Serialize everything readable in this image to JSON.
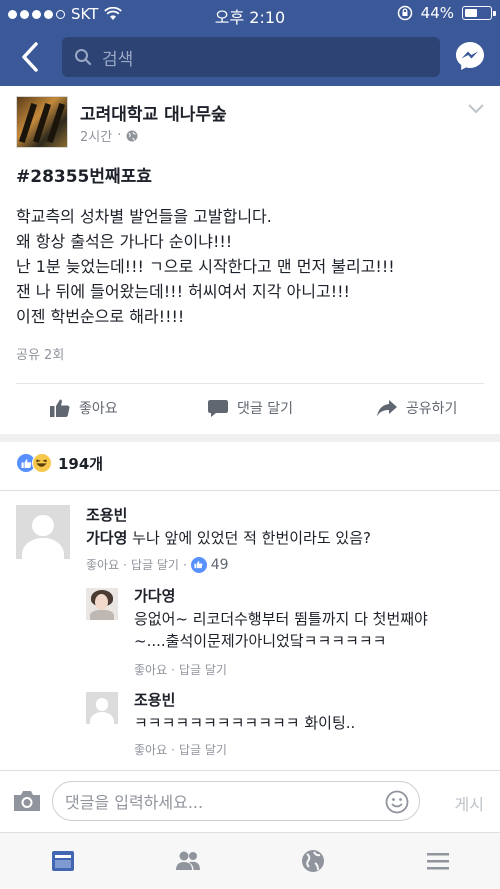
{
  "status": {
    "carrier": "SKT",
    "time": "오후 2:10",
    "battery": "44%",
    "battery_level": 0.44
  },
  "nav": {
    "search_placeholder": "검색"
  },
  "post": {
    "page_name": "고려대학교 대나무숲",
    "time": "2시간",
    "hashtag": "#28355번째포효",
    "lines": [
      "학교측의 성차별 발언들을 고발합니다.",
      "왜 항상 출석은 가나다 순이냐!!!",
      "난 1분 늦었는데!!! ㄱ으로 시작한다고 맨 먼저 불리고!!!",
      "잰 나 뒤에 들어왔는데!!! 허씨여서 지각 아니고!!!",
      "이젠 학번순으로 해라!!!!"
    ],
    "shares": "공유 2회"
  },
  "actions": {
    "like": "좋아요",
    "comment": "댓글 달기",
    "share": "공유하기"
  },
  "reactions": {
    "count": "194개"
  },
  "comments": [
    {
      "name": "조용빈",
      "tag": "가다영",
      "text": " 누나 앞에 있었던 적 한번이라도 있음?",
      "like": "좋아요",
      "reply": "답글 달기",
      "likes": "49"
    }
  ],
  "replies": [
    {
      "name": "가다영",
      "line1": "응없어~ 리코더수행부터 뜀틀까지 다 첫번째야",
      "line2": "~....출석이문제가아니었닼ㅋㅋㅋㅋㅋㅋ",
      "like": "좋아요",
      "reply": "답글 달기"
    },
    {
      "name": "조용빈",
      "line1": "ㅋㅋㅋㅋㅋㅋㅋㅋㅋㅋㅋㅋ 화이팅..",
      "like": "좋아요",
      "reply": "답글 달기"
    }
  ],
  "compose": {
    "placeholder": "댓글을 입력하세요...",
    "post": "게시"
  },
  "colors": {
    "brand": "#3b5998",
    "link": "#5890ff",
    "meta": "#90949c"
  }
}
